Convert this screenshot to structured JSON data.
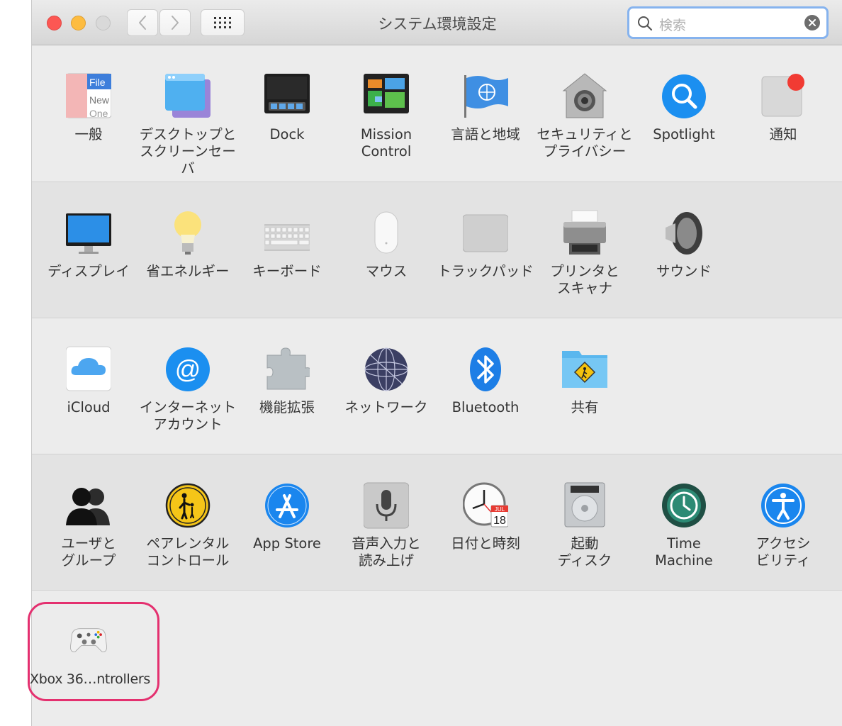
{
  "window": {
    "title": "システム環境設定",
    "search": {
      "placeholder": "検索"
    }
  },
  "toolbar": {
    "back_icon": "chevron-left-icon",
    "forward_icon": "chevron-right-icon",
    "show_all_icon": "grid-icon"
  },
  "rows": [
    {
      "items": [
        {
          "label": "一般",
          "icon": "general-icon",
          "icon_text": [
            "File",
            "New",
            "One"
          ]
        },
        {
          "label": "デスクトップと\nスクリーンセーバ",
          "icon": "desktop-screensaver-icon"
        },
        {
          "label": "Dock",
          "icon": "dock-icon"
        },
        {
          "label": "Mission\nControl",
          "icon": "mission-control-icon"
        },
        {
          "label": "言語と地域",
          "icon": "language-region-icon"
        },
        {
          "label": "セキュリティと\nプライバシー",
          "icon": "security-privacy-icon"
        },
        {
          "label": "Spotlight",
          "icon": "spotlight-icon"
        },
        {
          "label": "通知",
          "icon": "notifications-icon"
        }
      ]
    },
    {
      "items": [
        {
          "label": "ディスプレイ",
          "icon": "display-icon"
        },
        {
          "label": "省エネルギー",
          "icon": "energy-saver-icon"
        },
        {
          "label": "キーボード",
          "icon": "keyboard-icon"
        },
        {
          "label": "マウス",
          "icon": "mouse-icon"
        },
        {
          "label": "トラックパッド",
          "icon": "trackpad-icon"
        },
        {
          "label": "プリンタと\nスキャナ",
          "icon": "printer-scanner-icon"
        },
        {
          "label": "サウンド",
          "icon": "sound-icon"
        }
      ]
    },
    {
      "items": [
        {
          "label": "iCloud",
          "icon": "icloud-icon"
        },
        {
          "label": "インターネット\nアカウント",
          "icon": "internet-accounts-icon"
        },
        {
          "label": "機能拡張",
          "icon": "extensions-icon"
        },
        {
          "label": "ネットワーク",
          "icon": "network-icon"
        },
        {
          "label": "Bluetooth",
          "icon": "bluetooth-icon"
        },
        {
          "label": "共有",
          "icon": "sharing-icon"
        }
      ]
    },
    {
      "items": [
        {
          "label": "ユーザと\nグループ",
          "icon": "users-groups-icon"
        },
        {
          "label": "ペアレンタル\nコントロール",
          "icon": "parental-controls-icon"
        },
        {
          "label": "App Store",
          "icon": "app-store-icon"
        },
        {
          "label": "音声入力と\n読み上げ",
          "icon": "dictation-speech-icon"
        },
        {
          "label": "日付と時刻",
          "icon": "date-time-icon",
          "icon_text": [
            "JUL",
            "18"
          ]
        },
        {
          "label": "起動\nディスク",
          "icon": "startup-disk-icon"
        },
        {
          "label": "Time\nMachine",
          "icon": "time-machine-icon"
        },
        {
          "label": "アクセシ\nビリティ",
          "icon": "accessibility-icon"
        }
      ]
    },
    {
      "items": [
        {
          "label": "Xbox 36…ntrollers",
          "icon": "xbox-controller-icon",
          "highlighted": true
        }
      ]
    }
  ],
  "colors": {
    "highlight_border": "#e4306f",
    "search_focus": "#86b3ee"
  }
}
